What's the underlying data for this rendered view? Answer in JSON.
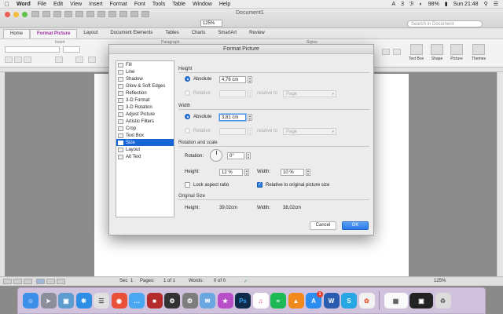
{
  "menubar": {
    "apple": "",
    "app": "Word",
    "items": [
      "File",
      "Edit",
      "View",
      "Insert",
      "Format",
      "Font",
      "Tools",
      "Table",
      "Window",
      "Help"
    ],
    "status_items": [
      "3",
      "98%",
      "Sun 21:48"
    ]
  },
  "window": {
    "title": "Document1",
    "zoom": "125%",
    "search_placeholder": "Search in Document"
  },
  "ribbon": {
    "tabs": [
      "Home",
      "Format Picture",
      "Layout",
      "Document Elements",
      "Tables",
      "Charts",
      "SmartArt",
      "Review"
    ],
    "active_tab": "Format Picture",
    "group_labels": [
      "Insert",
      "Paragraph",
      "Styles"
    ],
    "right_buttons": [
      "Text Box",
      "Shape",
      "Picture",
      "Themes"
    ]
  },
  "statusbar": {
    "view": "",
    "sec_label": "Sec",
    "sec_value": "1",
    "pages_label": "Pages:",
    "pages_value": "1 of 1",
    "words_label": "Words:",
    "words_value": "0 of 0",
    "zoom": "125%"
  },
  "dialog": {
    "title": "Format Picture",
    "categories": [
      "Fill",
      "Line",
      "Shadow",
      "Glow & Soft Edges",
      "Reflection",
      "3-D Format",
      "3-D Rotation",
      "Adjust Picture",
      "Artistic Filters",
      "Crop",
      "Text Box",
      "Size",
      "Layout",
      "Alt Text"
    ],
    "selected_category": "Size",
    "height": {
      "section": "Height",
      "absolute_label": "Absolute",
      "absolute_value": "4,76 cm",
      "relative_label": "Relative",
      "relative_to_label": "relative to",
      "relative_to_value": "Page"
    },
    "width": {
      "section": "Width",
      "absolute_label": "Absolute",
      "absolute_value": "3,81 cm",
      "relative_label": "Relative",
      "relative_to_label": "relative to",
      "relative_to_value": "Page"
    },
    "rotate_scale": {
      "section": "Rotation and scale",
      "rotation_label": "Rotation:",
      "rotation_value": "0°",
      "height_label": "Height:",
      "height_value": "12 %",
      "width_label": "Width:",
      "width_value": "10 %",
      "lock_label": "Lock aspect ratio",
      "lock_checked": false,
      "relative_label": "Relative to original picture size",
      "relative_checked": true
    },
    "original": {
      "section": "Original Size",
      "height_label": "Height:",
      "height_value": "39,02cm",
      "width_label": "Width:",
      "width_value": "38,02cm"
    },
    "cancel_label": "Cancel",
    "ok_label": "OK"
  },
  "dock": {
    "apps": [
      "finder-icon",
      "launchpad-icon",
      "preview-icon",
      "safari-icon",
      "textedit-icon",
      "chrome-icon",
      "messages-icon",
      "photobooth-icon",
      "activity-monitor-icon",
      "system-preferences-icon",
      "mail-icon",
      "facetime-icon",
      "photoshop-icon",
      "itunes-icon",
      "spotify-icon",
      "vlc-icon",
      "appstore-icon",
      "word-icon",
      "skype-icon",
      "photos-icon",
      "calendar-icon",
      "screenshot-icon",
      "trash-icon"
    ],
    "appstore_badge": "1",
    "ps_label": "Ps",
    "word_label": "W",
    "skype_label": "S"
  },
  "colors": {
    "accent": "#2b7be0",
    "ok_button": "#2a7ae6",
    "selected_row": "#1766d6",
    "active_tab": "#9b2fa0"
  }
}
